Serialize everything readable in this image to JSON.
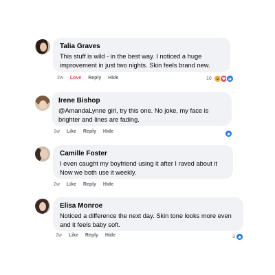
{
  "comments": [
    {
      "name": "Talia Graves",
      "text": "This stuff is wild - in the best way. I noticed a huge improvement in just two nights. Skin feels brand new.",
      "time": "2w",
      "like_label": "Love",
      "reply_label": "Reply",
      "hide_label": "Hide",
      "reaction_count": "10",
      "reactions": [
        "haha-icon",
        "love-icon",
        "like-icon"
      ]
    },
    {
      "name": "Irene Bishop",
      "text": "@AmandaLynne girl, try this one. No joke, my face is brighter and lines are fading.",
      "time": "1w",
      "like_label": "Like",
      "reply_label": "Reply",
      "hide_label": "Hide",
      "reaction_count": "",
      "reactions": [
        "like-icon"
      ]
    },
    {
      "name": "Camille Foster",
      "text": "I even caught my boyfriend using it after I raved about it  Now we both use it weekly.",
      "time": "2w",
      "like_label": "Like",
      "reply_label": "Reply",
      "hide_label": "Hide",
      "reaction_count": "",
      "reactions": []
    },
    {
      "name": "Elisa Monroe",
      "text": "Noticed a difference the next day. Skin tone looks more even and it feels baby soft.",
      "time": "2w",
      "like_label": "Like",
      "reply_label": "Reply",
      "hide_label": "Hide",
      "reaction_count": "3",
      "reactions": [
        "like-icon"
      ]
    }
  ],
  "colors": {
    "bubble": "#f0f2f5",
    "like_blue": "#1877f2",
    "love_red": "#f33e58",
    "haha_yellow": "#f7b125",
    "meta_gray": "#65676b"
  }
}
